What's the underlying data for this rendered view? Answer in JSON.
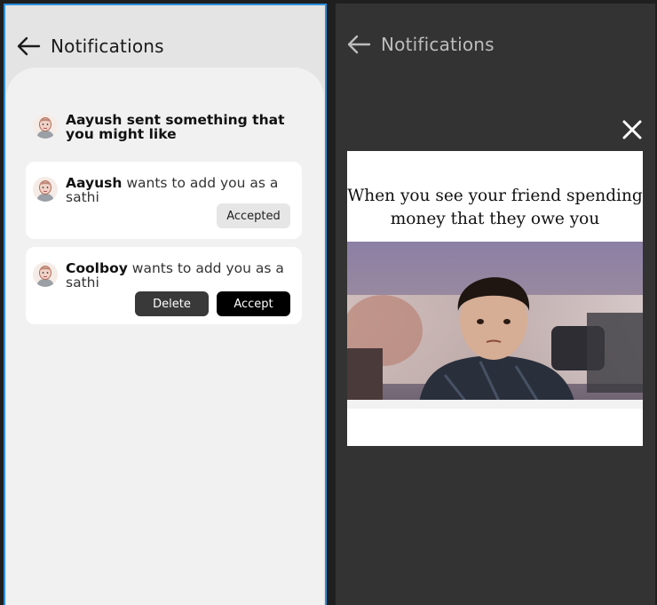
{
  "left_screen": {
    "header": {
      "title": "Notifications",
      "back_icon": "arrow-left-icon"
    },
    "notifications": [
      {
        "text": "Aayush sent something that you might like",
        "avatar_icon": "avatar-icon"
      },
      {
        "name": "Aayush",
        "text": " wants to add you as a sathi",
        "status_label": "Accepted",
        "avatar_icon": "avatar-icon"
      },
      {
        "name": "Coolboy",
        "text": " wants to add you as a sathi",
        "delete_label": "Delete",
        "accept_label": "Accept",
        "avatar_icon": "avatar-icon"
      }
    ]
  },
  "right_screen": {
    "header": {
      "title": "Notifications",
      "back_icon": "arrow-left-icon"
    },
    "close_icon": "close-icon",
    "meme": {
      "caption_line1": "When you see your friend spending",
      "caption_line2": "money that they owe you"
    }
  },
  "colors": {
    "accent_border": "#2b8fde",
    "dark_bg": "#333333",
    "sheet_bg": "#f1f1f1",
    "button_dark": "#393939",
    "button_black": "#000000"
  }
}
